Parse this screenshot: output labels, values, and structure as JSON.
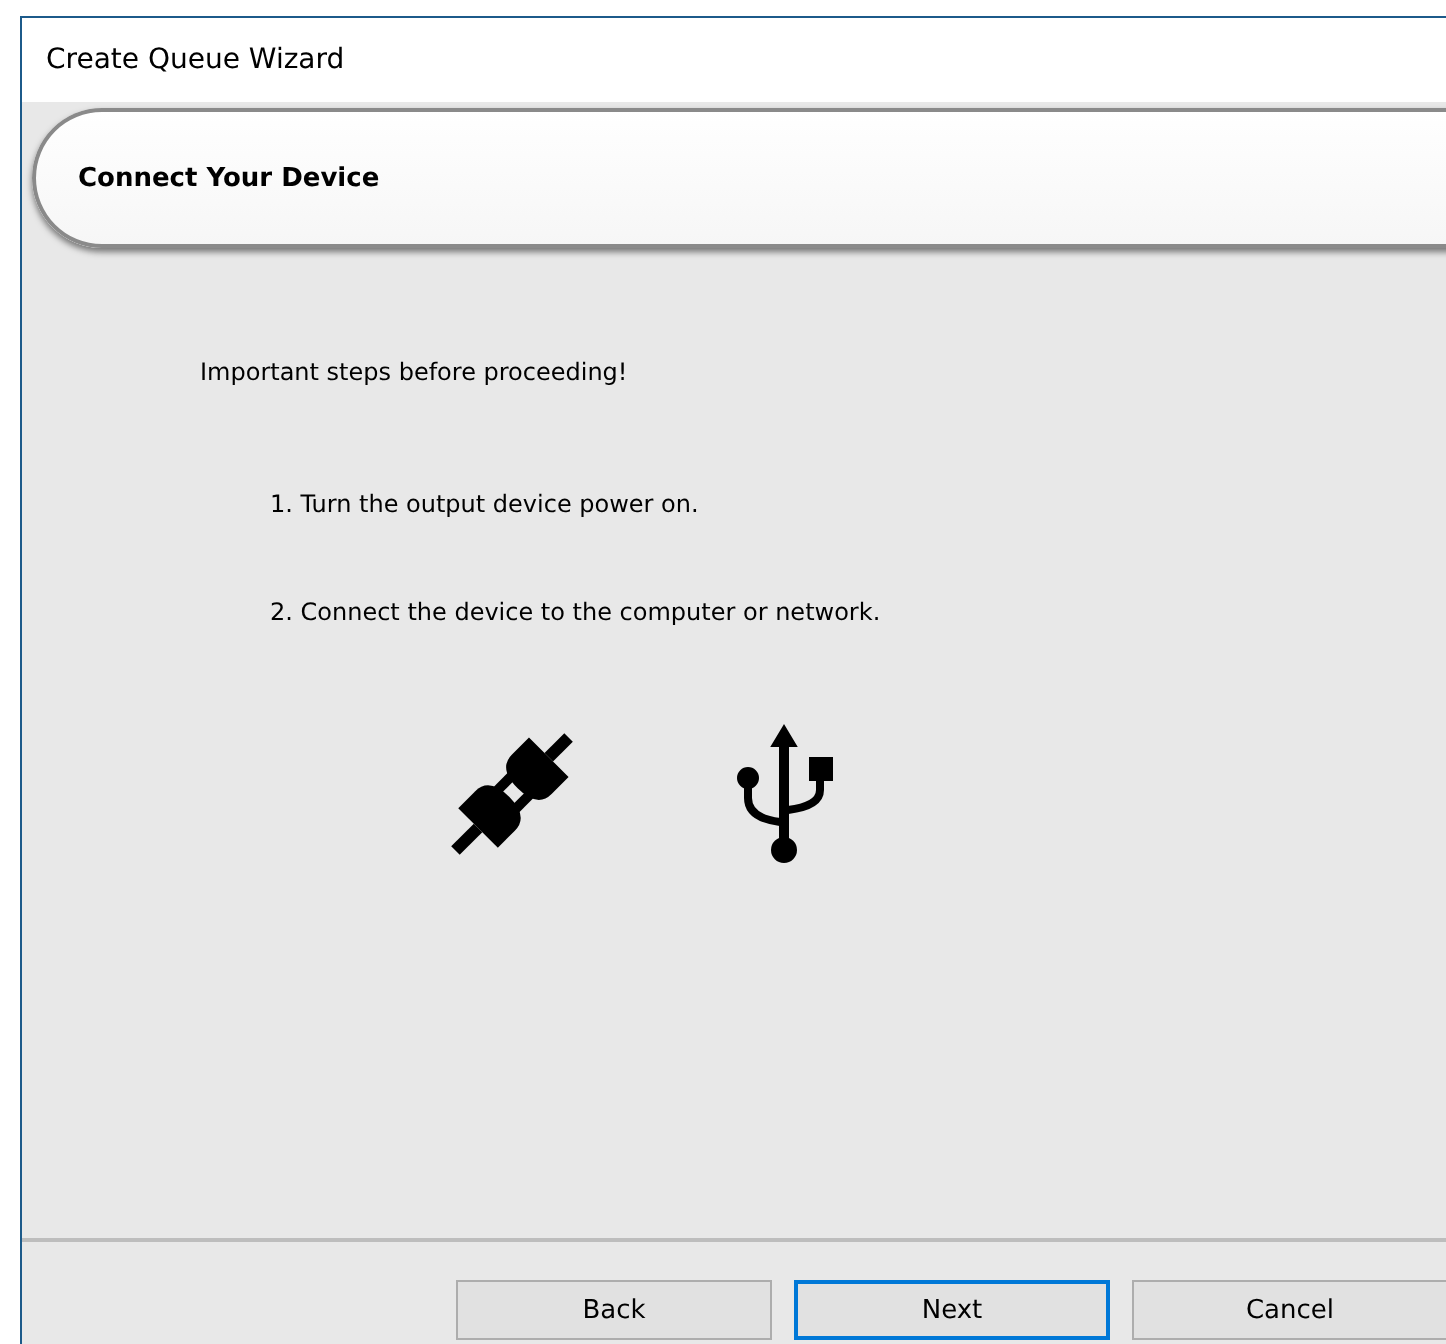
{
  "window": {
    "title": "Create Queue Wizard"
  },
  "header": {
    "title": "Connect Your Device"
  },
  "intro": "Important steps before proceeding!",
  "steps": [
    "1. Turn the output device power on.",
    "2. Connect the device to the computer or network."
  ],
  "buttons": [
    {
      "label": "Back",
      "default": false
    },
    {
      "label": "Next",
      "default": true
    },
    {
      "label": "Cancel",
      "default": false
    }
  ]
}
